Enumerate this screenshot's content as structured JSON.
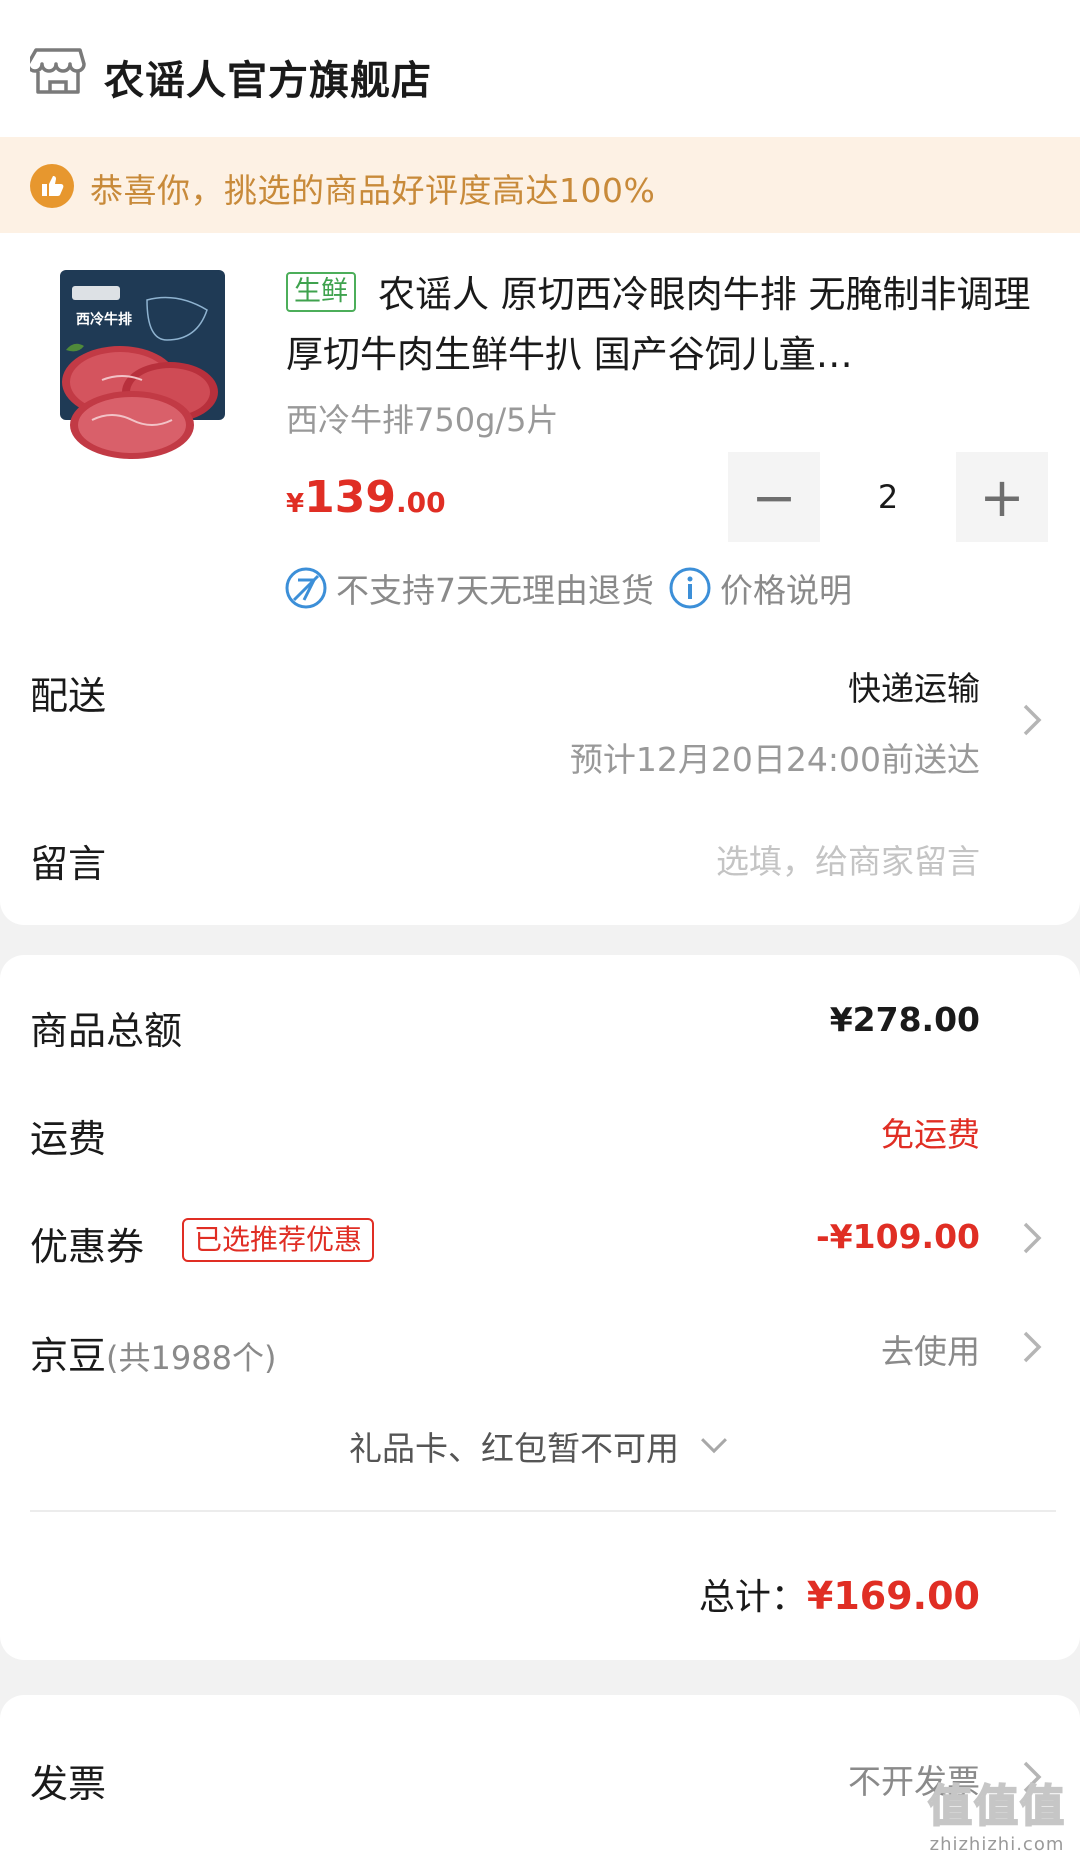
{
  "store": {
    "name": "农谣人官方旗舰店",
    "icon": "store-icon"
  },
  "praise": {
    "icon": "thumbs-up-icon",
    "text": "恭喜你，挑选的商品好评度高达100%"
  },
  "product": {
    "image_icon": "steak-product-image",
    "tag": "生鲜",
    "title": "农谣人 原切西冷眼肉牛排 无腌制非调理厚切牛肉生鲜牛扒 国产谷饲儿童…",
    "spec": "西冷牛排750g/5片",
    "price_currency": "¥",
    "price_int": "139",
    "price_dec": ".00",
    "quantity": "2",
    "minus_label": "−",
    "plus_label": "+",
    "no_return_text": "不支持7天无理由退货",
    "price_info_text": "价格说明"
  },
  "delivery": {
    "label": "配送",
    "method": "快递运输",
    "eta": "预计12月20日24:00前送达"
  },
  "message": {
    "label": "留言",
    "placeholder": "选填，给商家留言"
  },
  "summary": {
    "goods_label": "商品总额",
    "goods_value": "¥278.00",
    "shipping_label": "运费",
    "shipping_value": "免运费",
    "coupon_label": "优惠券",
    "coupon_badge": "已选推荐优惠",
    "coupon_value": "-¥109.00",
    "beans_label": "京豆",
    "beans_count": "(共1988个)",
    "beans_action": "去使用",
    "giftcard_text": "礼品卡、红包暂不可用",
    "total_label": "总计：",
    "total_value": "¥169.00"
  },
  "invoice": {
    "label": "发票",
    "value": "不开发票"
  },
  "watermark": {
    "big": "值值值",
    "small": "zhizhizhi.com"
  },
  "colors": {
    "accent_red": "#e02e24",
    "praise_gold": "#c88a3a",
    "fresh_green": "#3fa24e",
    "secondary_text": "#999999"
  }
}
